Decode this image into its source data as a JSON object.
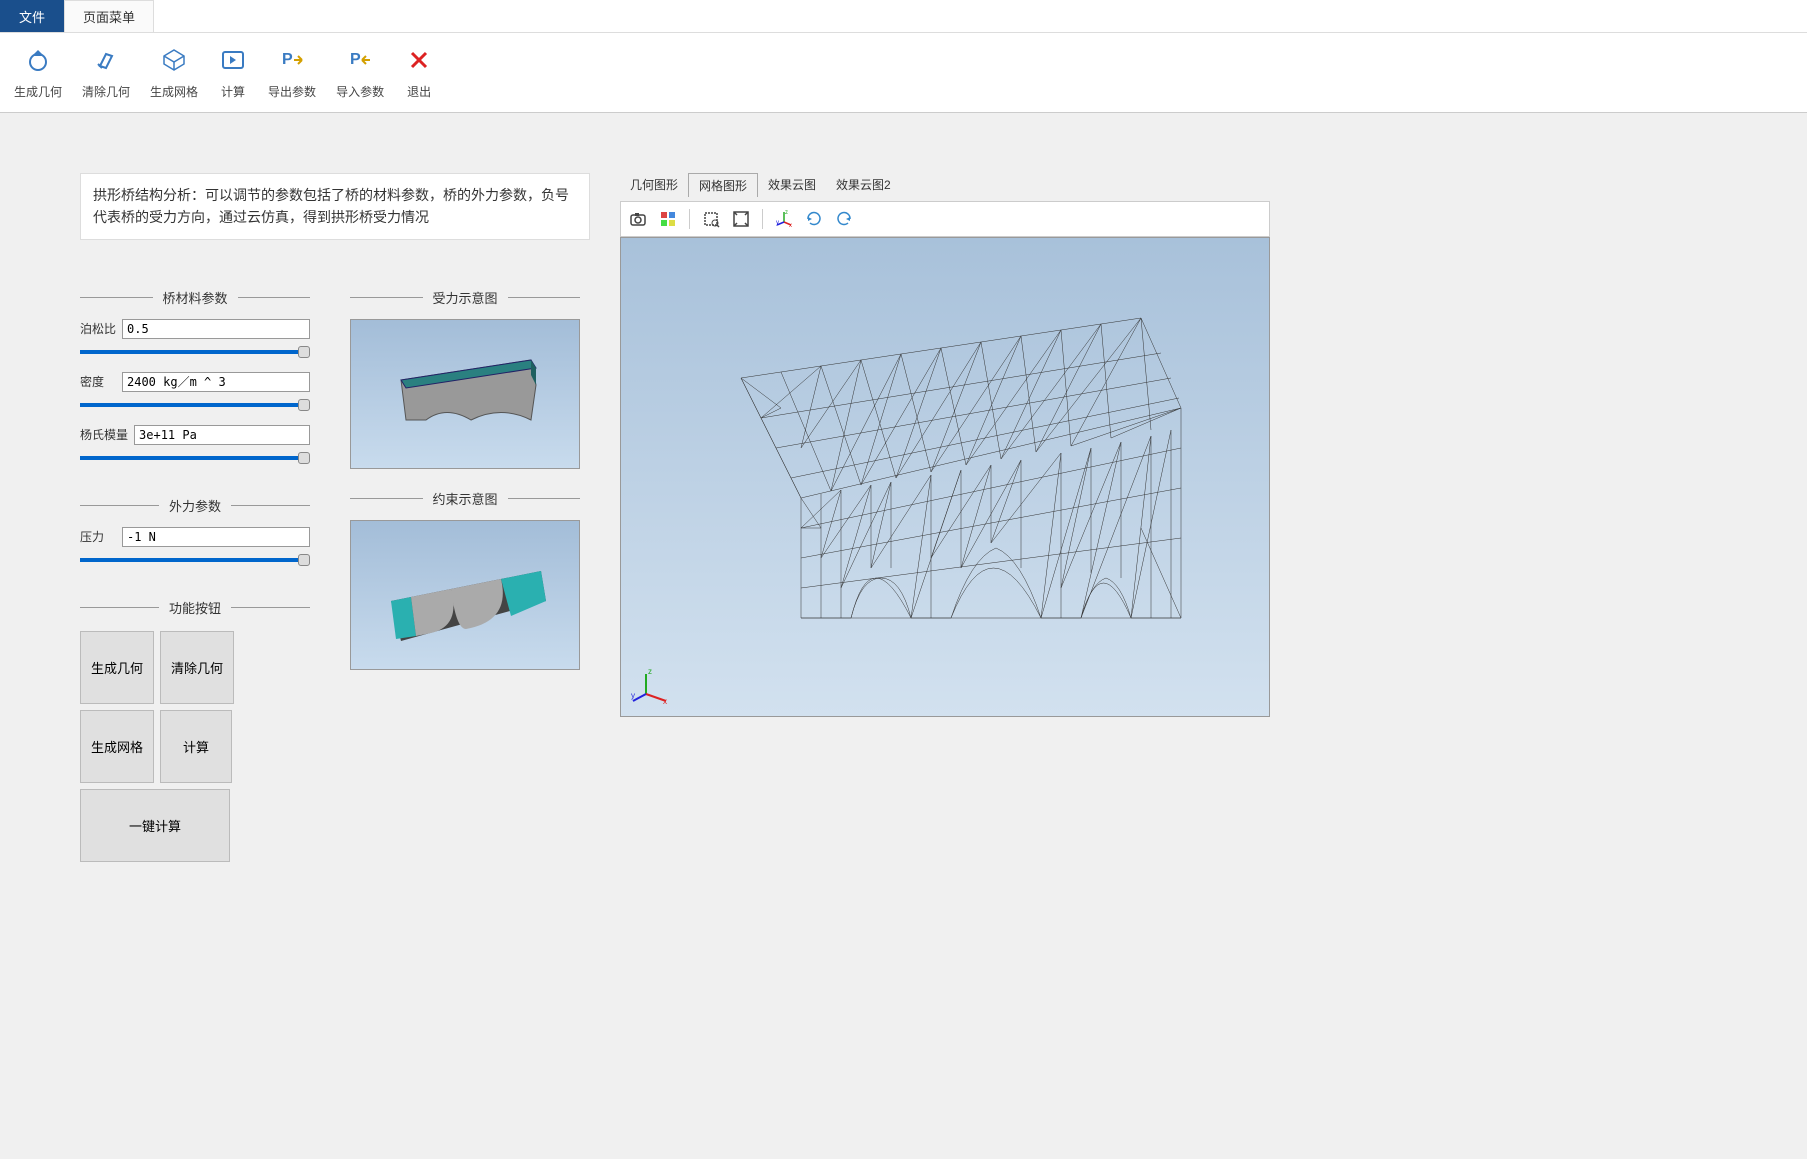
{
  "menu": {
    "tabs": [
      "文件",
      "页面菜单"
    ],
    "activeIndex": 0
  },
  "toolbar": {
    "items": [
      {
        "label": "生成几何",
        "icon": "geometry-icon"
      },
      {
        "label": "清除几何",
        "icon": "clear-geometry-icon"
      },
      {
        "label": "生成网格",
        "icon": "mesh-icon"
      },
      {
        "label": "计算",
        "icon": "compute-icon"
      },
      {
        "label": "导出参数",
        "icon": "export-params-icon"
      },
      {
        "label": "导入参数",
        "icon": "import-params-icon"
      },
      {
        "label": "退出",
        "icon": "exit-icon"
      }
    ]
  },
  "description": "拱形桥结构分析：可以调节的参数包括了桥的材料参数，桥的外力参数，负号代表桥的受力方向，通过云仿真，得到拱形桥受力情况",
  "sections": {
    "material": "桥材料参数",
    "force": "外力参数",
    "functions": "功能按钮",
    "forceDiagram": "受力示意图",
    "constraintDiagram": "约束示意图"
  },
  "params": {
    "poisson": {
      "label": "泊松比",
      "value": "0.5"
    },
    "density": {
      "label": "密度",
      "value": "2400 kg／m ^ 3"
    },
    "youngs": {
      "label": "杨氏模量",
      "value": "3e+11 Pa"
    },
    "pressure": {
      "label": "压力",
      "value": "-1 N"
    }
  },
  "buttons": {
    "genGeom": "生成几何",
    "clearGeom": "清除几何",
    "genMesh": "生成网格",
    "compute": "计算",
    "oneClick": "一键计算"
  },
  "viewerTabs": [
    "几何图形",
    "网格图形",
    "效果云图",
    "效果云图2"
  ],
  "viewerActiveTab": 1,
  "viewerToolbar": [
    "camera-icon",
    "select-mode-icon",
    "zoom-window-icon",
    "zoom-extent-icon",
    "axis-icon",
    "rotate-cw-icon",
    "rotate-ccw-icon"
  ]
}
